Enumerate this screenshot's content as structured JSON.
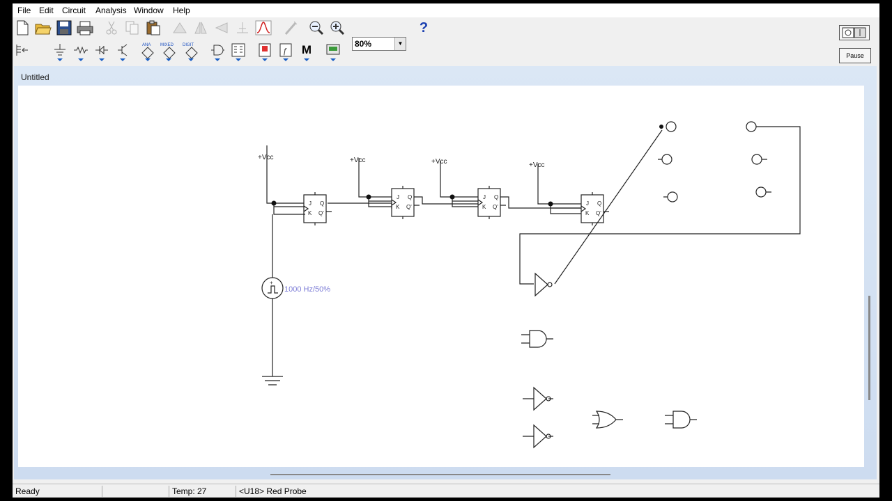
{
  "menu": {
    "items": [
      "File",
      "Edit",
      "Circuit",
      "Analysis",
      "Window",
      "Help"
    ]
  },
  "toolbar": {
    "zoom_value": "80%",
    "help_label": "?",
    "pause_label": "Pause",
    "parts_bins": [
      "ANA",
      "MIXED",
      "DIGIT"
    ],
    "misc_label": "M"
  },
  "document": {
    "title": "Untitled"
  },
  "circuit": {
    "vcc_labels": [
      "+Vcc",
      "+Vcc",
      "+Vcc",
      "+Vcc"
    ],
    "flipflop_pins": {
      "j": "J",
      "k": "K",
      "q": "Q",
      "qn": "Q'"
    },
    "clock_label": "1000 Hz/50%",
    "clock_symbol": "+"
  },
  "status": {
    "ready": "Ready",
    "temp": "Temp:  27",
    "selected": "<U18> Red Probe"
  },
  "colors": {
    "doc_title_bar": "#cddcf0",
    "clock_label_color": "#7b7bd6",
    "help_icon": "#1a3fb0"
  }
}
